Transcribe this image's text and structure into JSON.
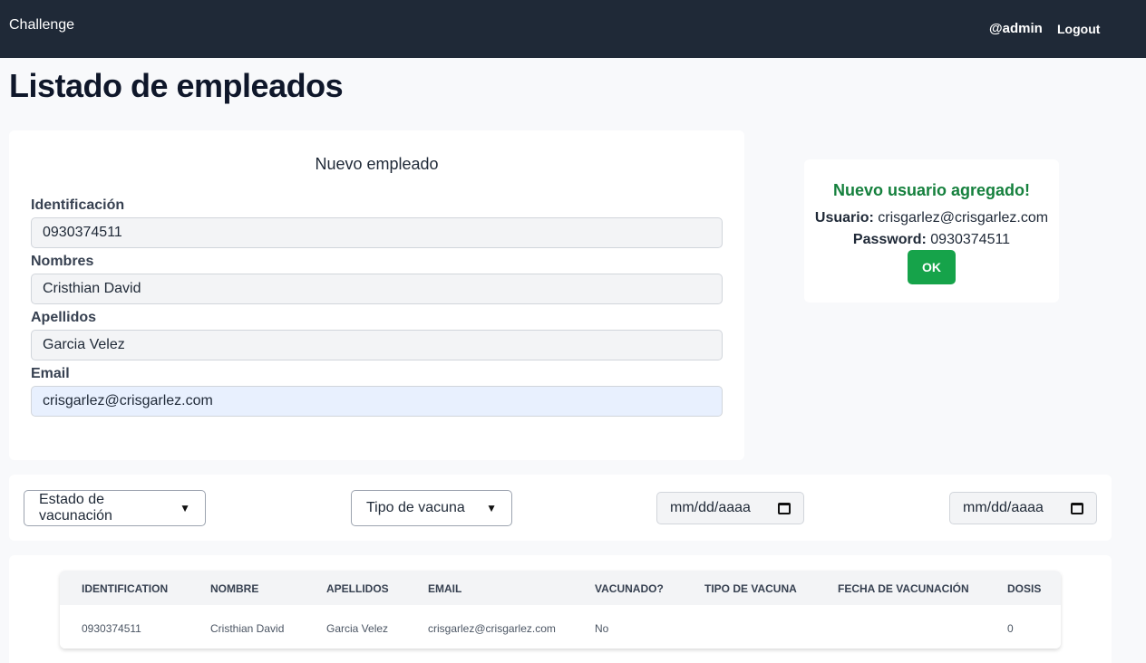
{
  "navbar": {
    "brand": "Challenge",
    "user": "@admin",
    "logout": "Logout"
  },
  "page": {
    "title": "Listado de empleados"
  },
  "form": {
    "title": "Nuevo empleado",
    "fields": [
      {
        "label": "Identificación",
        "value": "0930374511"
      },
      {
        "label": "Nombres",
        "value": "Cristhian David"
      },
      {
        "label": "Apellidos",
        "value": "Garcia Velez"
      },
      {
        "label": "Email",
        "value": "crisgarlez@crisgarlez.com"
      }
    ]
  },
  "alert": {
    "title": "Nuevo usuario agregado!",
    "user_label": "Usuario:",
    "user_value": "crisgarlez@crisgarlez.com",
    "password_label": "Password:",
    "password_value": "0930374511",
    "ok": "OK",
    "accent": "#15803d",
    "button_color": "#16a34a"
  },
  "filters": {
    "vaccination_status": "Estado de vacunación",
    "vaccine_type": "Tipo de vacuna",
    "date_from": "mm/dd/aaaa",
    "date_to": "mm/dd/aaaa"
  },
  "table": {
    "headers": [
      "IDENTIFICATION",
      "NOMBRE",
      "APELLIDOS",
      "EMAIL",
      "VACUNADO?",
      "TIPO DE VACUNA",
      "FECHA DE VACUNACIÓN",
      "DOSIS"
    ],
    "rows": [
      [
        "0930374511",
        "Cristhian David",
        "Garcia Velez",
        "crisgarlez@crisgarlez.com",
        "No",
        "",
        "",
        "0"
      ]
    ]
  }
}
